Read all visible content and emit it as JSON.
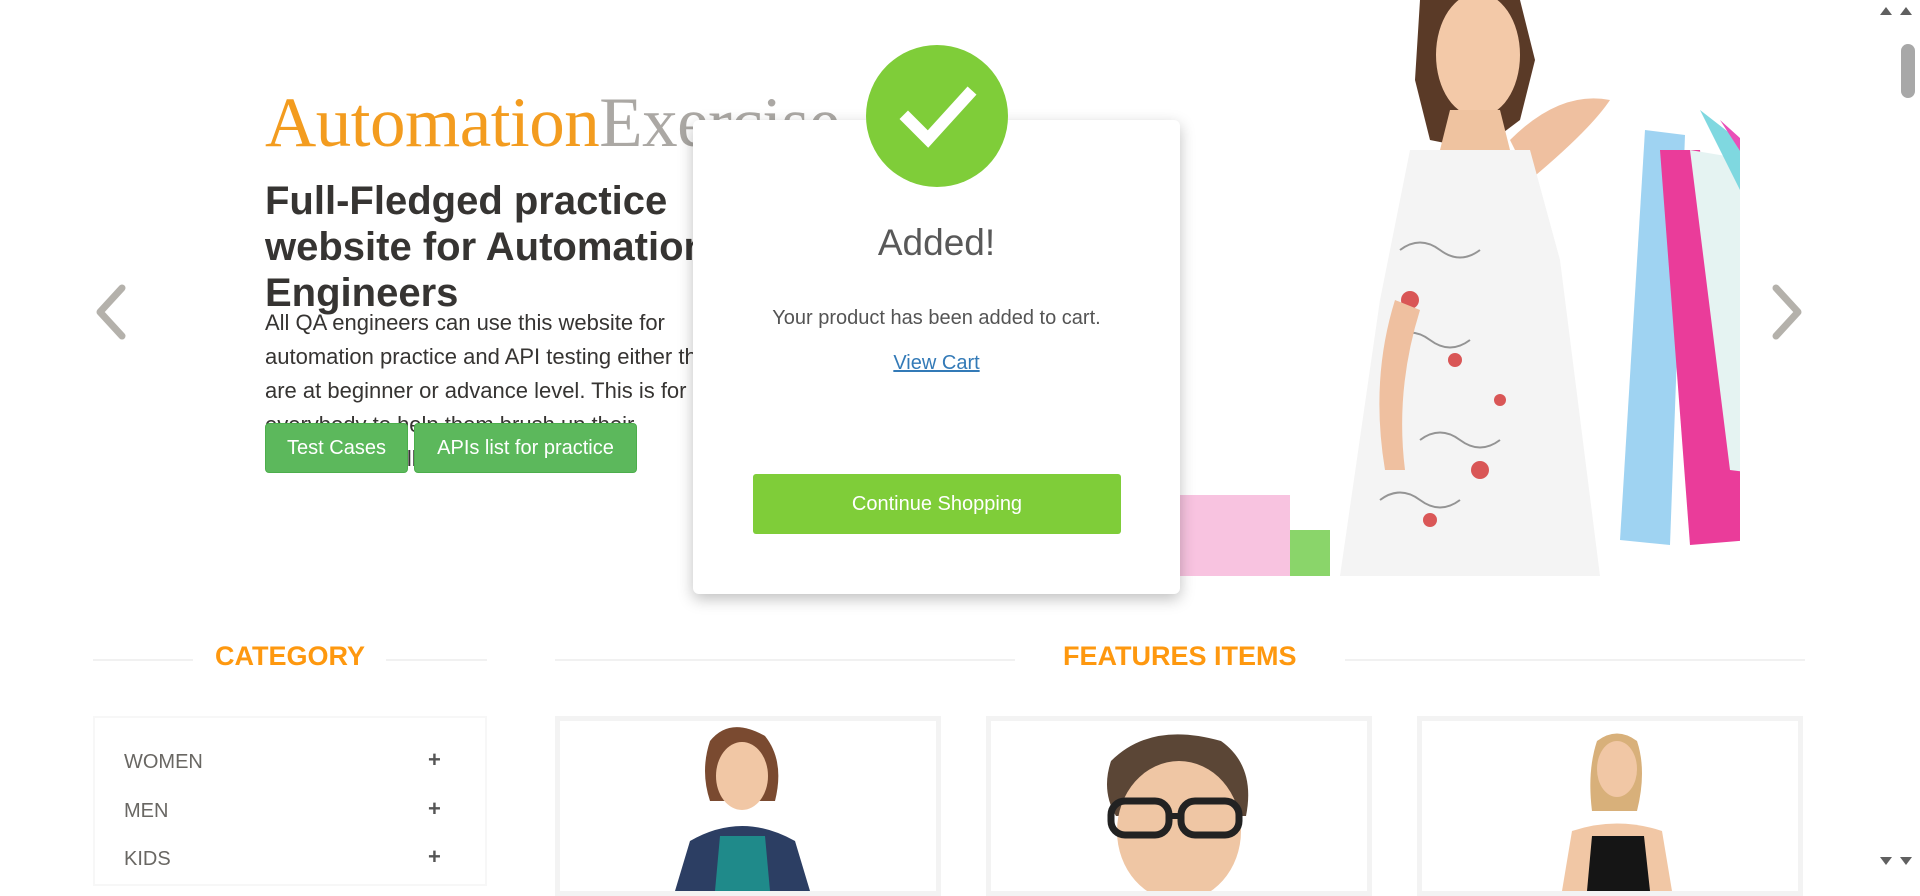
{
  "brand": {
    "part1": "Automation",
    "part2": "Exercise"
  },
  "hero": {
    "heading": "Full-Fledged practice website for Automation Engineers",
    "text": "All QA engineers can use this website for automation practice and API testing either they are at beginner or advance level. This is for everybody to help them brush up their automation skills.",
    "buttons": {
      "test_cases": "Test Cases",
      "apis_list": "APIs list for practice"
    }
  },
  "carousel": {
    "prev_icon": "chevron-left-icon",
    "next_icon": "chevron-right-icon"
  },
  "sections": {
    "category_title": "CATEGORY",
    "features_title": "FEATURES ITEMS"
  },
  "categories": [
    {
      "label": "WOMEN"
    },
    {
      "label": "MEN"
    },
    {
      "label": "KIDS"
    }
  ],
  "modal": {
    "title": "Added!",
    "message": "Your product has been added to cart.",
    "link": "View Cart",
    "button": "Continue Shopping",
    "icon": "checkmark-icon"
  },
  "colors": {
    "brand_orange": "#fe980f",
    "brand_grey": "#aba8a4",
    "button_green": "#5cb85c",
    "success_green": "#7fcd39",
    "link_blue": "#337ab7"
  }
}
